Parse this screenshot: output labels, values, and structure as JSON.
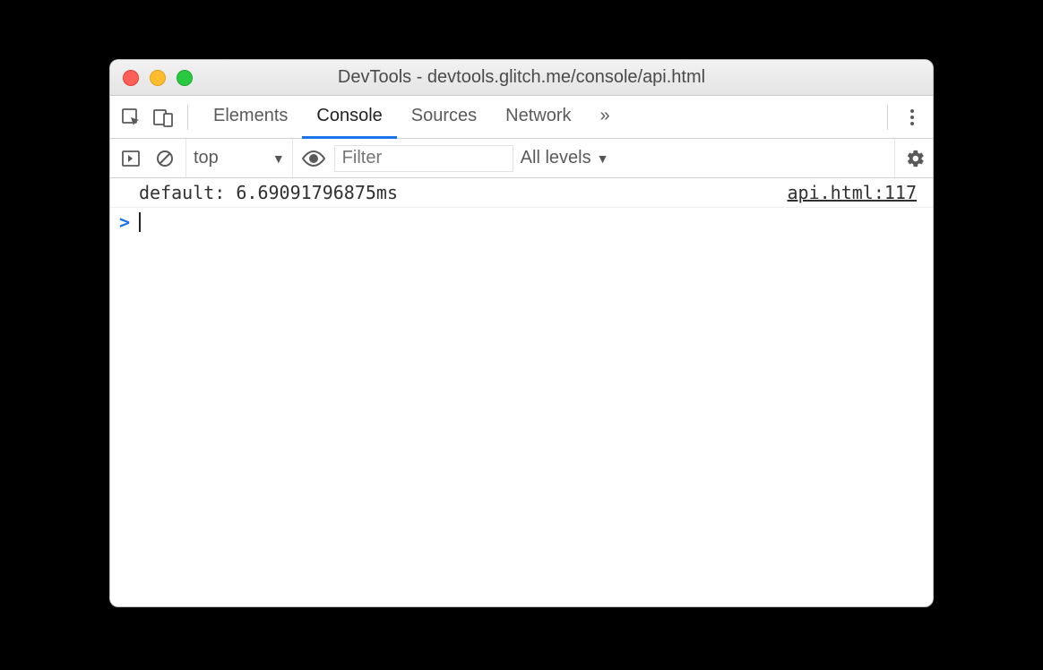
{
  "window": {
    "title": "DevTools - devtools.glitch.me/console/api.html"
  },
  "panelbar": {
    "tabs": [
      {
        "label": "Elements",
        "active": false
      },
      {
        "label": "Console",
        "active": true
      },
      {
        "label": "Sources",
        "active": false
      },
      {
        "label": "Network",
        "active": false
      }
    ],
    "overflow_glyph": "»"
  },
  "toolbar": {
    "context": "top",
    "filter_placeholder": "Filter",
    "levels_label": "All levels"
  },
  "console": {
    "logs": [
      {
        "text": "default: 6.69091796875ms",
        "source": "api.html:117"
      }
    ],
    "prompt_glyph": ">"
  }
}
